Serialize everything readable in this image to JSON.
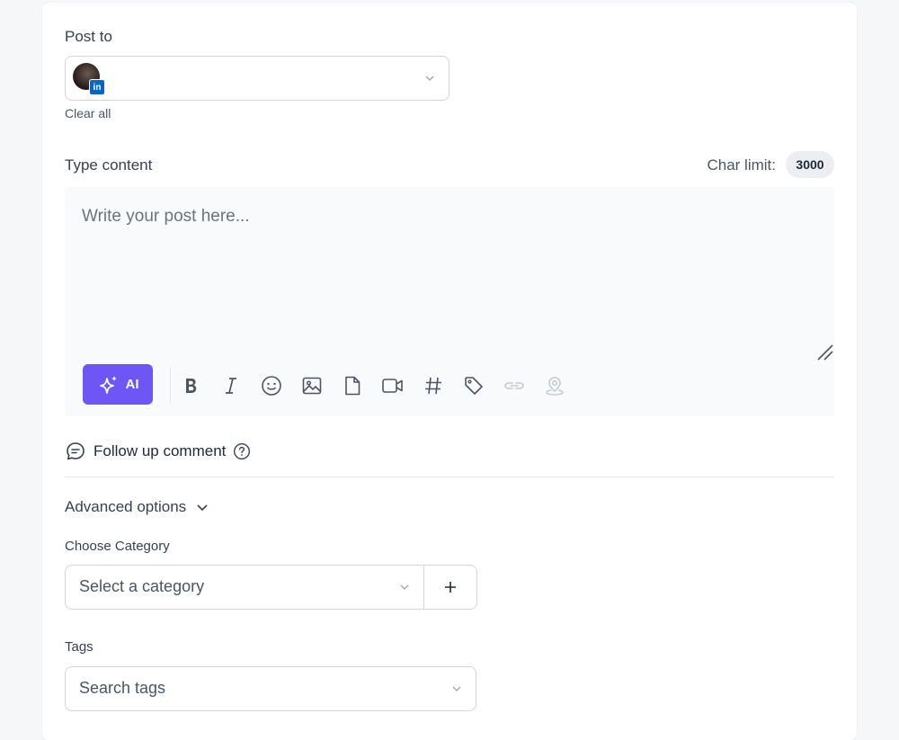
{
  "post_to": {
    "label": "Post to",
    "account_network": "in",
    "clear_label": "Clear all"
  },
  "content": {
    "label": "Type content",
    "char_limit_label": "Char limit:",
    "char_limit_value": "3000",
    "placeholder": "Write your post here...",
    "ai_label": "AI",
    "toolbar_icons": [
      "bold-icon",
      "italic-icon",
      "emoji-icon",
      "image-icon",
      "document-icon",
      "video-icon",
      "hashtag-icon",
      "tag-icon",
      "link-icon",
      "location-icon"
    ]
  },
  "follow_up": {
    "label": "Follow up comment"
  },
  "advanced": {
    "label": "Advanced options"
  },
  "category": {
    "label": "Choose Category",
    "placeholder": "Select a category"
  },
  "tags": {
    "label": "Tags",
    "placeholder": "Search tags"
  },
  "colors": {
    "accent": "#6d56f5",
    "linkedin": "#0a66c2"
  }
}
